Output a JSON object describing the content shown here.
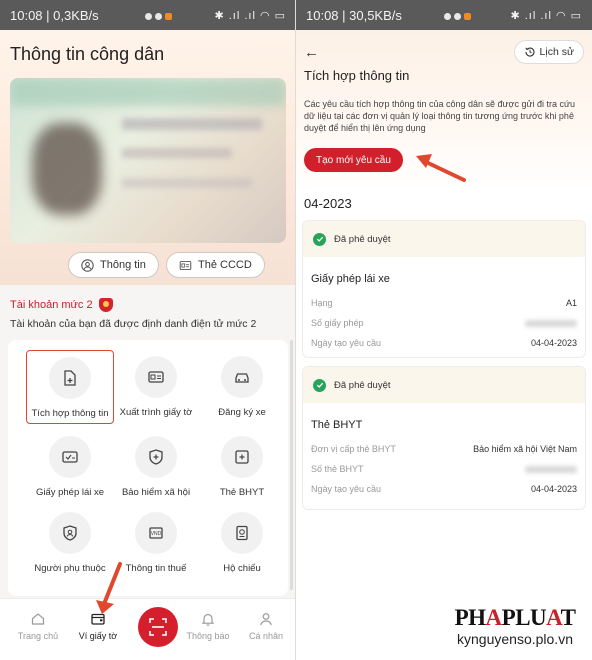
{
  "left_screen": {
    "status": {
      "time": "10:08 | 0,3KB/s"
    },
    "title": "Thông tin công dân",
    "buttons": {
      "info": "Thông tin",
      "cccd": "Thẻ CCCD"
    },
    "account": {
      "level": "Tài khoản mức 2",
      "desc": "Tài khoản của bạn đã được định danh điện tử mức 2"
    },
    "tiles": [
      {
        "label": "Tích hợp thông tin",
        "icon": "file-add-icon"
      },
      {
        "label": "Xuất trình giấy tờ",
        "icon": "id-card-icon"
      },
      {
        "label": "Đăng ký xe",
        "icon": "car-icon"
      },
      {
        "label": "Giấy phép lái xe",
        "icon": "license-icon"
      },
      {
        "label": "Bảo hiểm xã hội",
        "icon": "insurance-icon"
      },
      {
        "label": "Thẻ BHYT",
        "icon": "health-card-icon"
      },
      {
        "label": "Người phụ thuộc",
        "icon": "dependent-icon"
      },
      {
        "label": "Thông tin thuế",
        "icon": "tax-icon"
      },
      {
        "label": "Hộ chiếu",
        "icon": "passport-icon"
      }
    ],
    "nav": [
      {
        "label": "Trang chủ",
        "icon": "home-icon"
      },
      {
        "label": "Ví giấy tờ",
        "icon": "wallet-icon"
      },
      {
        "label": "Thông báo",
        "icon": "bell-icon"
      },
      {
        "label": "Cá nhân",
        "icon": "user-icon"
      }
    ]
  },
  "right_screen": {
    "status": {
      "time": "10:08 | 30,5KB/s"
    },
    "history": "Lịch sử",
    "title": "Tích hợp thông tin",
    "desc": "Các yêu cầu tích hợp thông tin của công dân sẽ được gửi đi tra cứu dữ liệu tại các đơn vị quản lý loại thông tin tương ứng trước khi phê duyệt để hiển thị lên ứng dụng",
    "new_request": "Tạo mới yêu cầu",
    "month": "04-2023",
    "requests": [
      {
        "status": "Đã phê duyệt",
        "name": "Giấy phép lái xe",
        "rows": [
          {
            "k": "Hạng",
            "v": "A1"
          },
          {
            "k": "Số giấy phép",
            "v": ""
          },
          {
            "k": "Ngày tạo yêu cầu",
            "v": "04-04-2023"
          }
        ]
      },
      {
        "status": "Đã phê duyệt",
        "name": "Thẻ BHYT",
        "rows": [
          {
            "k": "Đơn vị cấp thẻ BHYT",
            "v": "Bảo hiểm xã hội Việt Nam"
          },
          {
            "k": "Số thẻ BHYT",
            "v": ""
          },
          {
            "k": "Ngày tạo yêu cầu",
            "v": "04-04-2023"
          }
        ]
      }
    ]
  },
  "watermark": {
    "logo_a": "PH",
    "logo_b": "A",
    "logo_c": "PLU",
    "logo_d": "A",
    "logo_e": "T",
    "site": "kynguyenso.plo.vn"
  },
  "colors": {
    "accent": "#d21f2b",
    "approved": "#27a35a",
    "annotation_arrow": "#e0472e"
  }
}
